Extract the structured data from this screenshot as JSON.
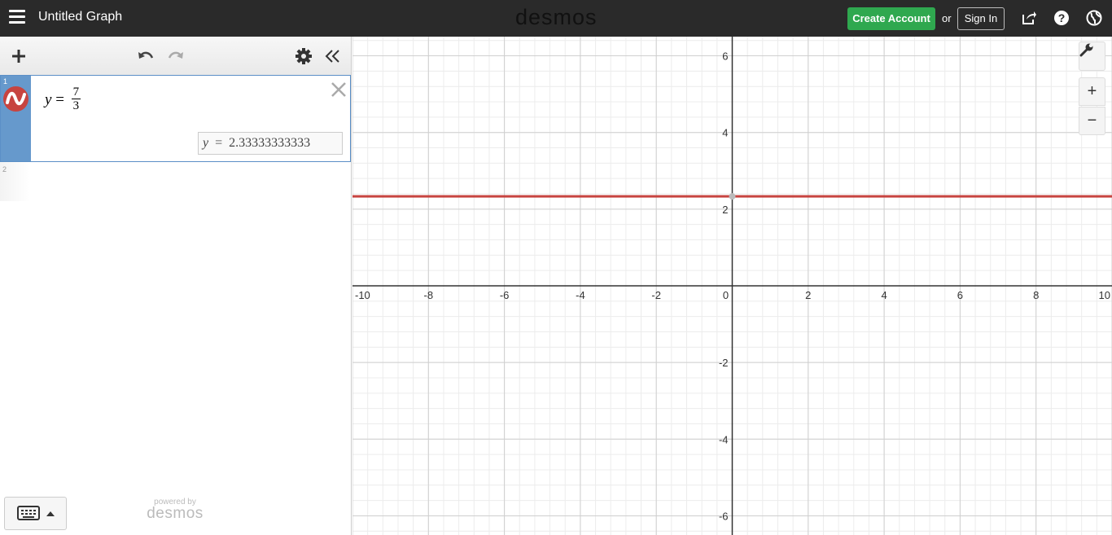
{
  "header": {
    "title": "Untitled Graph",
    "brand": "desmos",
    "create_account": "Create Account",
    "or": "or",
    "sign_in": "Sign In",
    "icons": [
      "menu-icon",
      "share-icon",
      "help-icon",
      "language-icon"
    ]
  },
  "toolbar": {
    "icons": [
      "add-icon",
      "undo-icon",
      "redo-icon",
      "settings-icon",
      "collapse-icon"
    ]
  },
  "expressions": [
    {
      "number": "1",
      "latex_lhs": "y",
      "equals": "=",
      "numerator": "7",
      "denominator": "3",
      "evaluation_var": "y",
      "evaluation_eq": "=",
      "evaluation_value": "2.33333333333",
      "color": "#c74440"
    },
    {
      "number": "2"
    }
  ],
  "footer": {
    "powered_by": "powered by",
    "brand": "desmos"
  },
  "graph": {
    "x_range": [
      -10,
      10
    ],
    "y_range": [
      -6.5,
      6.5
    ],
    "x_ticks": [
      "-10",
      "-8",
      "-6",
      "-4",
      "-2",
      "0",
      "2",
      "4",
      "6",
      "8",
      "10"
    ],
    "y_ticks": [
      "6",
      "4",
      "2",
      "-2",
      "-4",
      "-6"
    ],
    "line_value": 2.33333333333,
    "line_color": "#c74440",
    "controls": [
      "wrench-icon",
      "zoom-in-icon",
      "zoom-out-icon"
    ]
  }
}
